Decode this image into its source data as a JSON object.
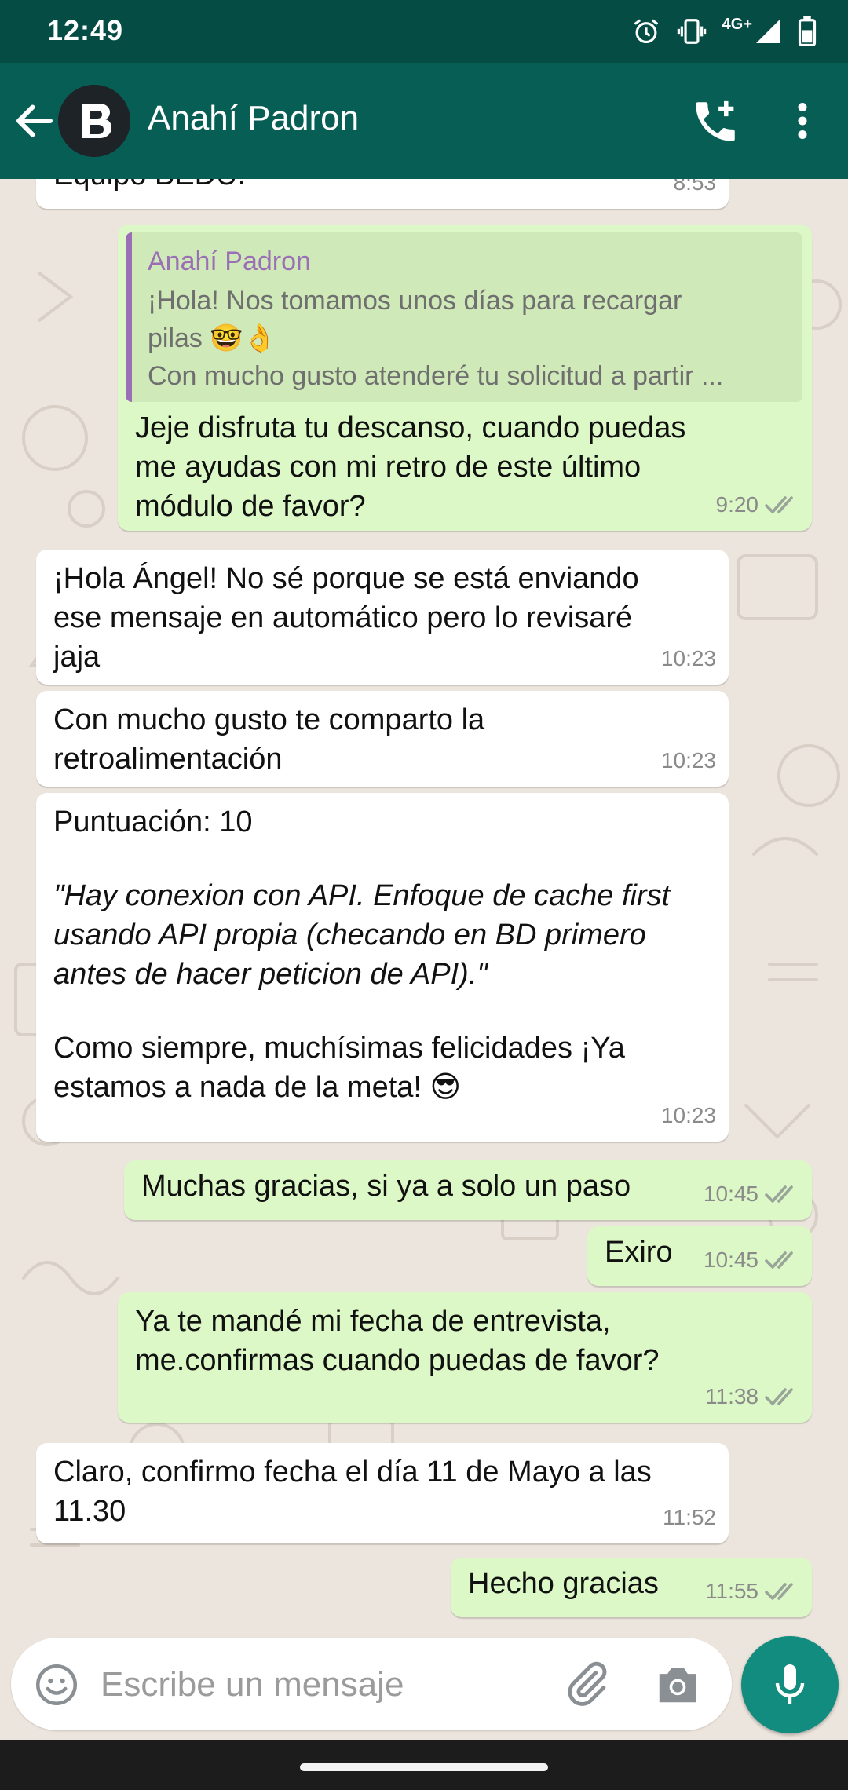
{
  "status_bar": {
    "time": "12:49",
    "network": "4G+",
    "icons": [
      "alarm-icon",
      "vibrate-icon",
      "signal-icon",
      "battery-icon"
    ]
  },
  "header": {
    "contact_name": "Anahí Padron",
    "avatar_letter": "B",
    "icons": [
      "back-arrow-icon",
      "add-call-icon",
      "more-vert-icon"
    ]
  },
  "messages": [
    {
      "direction": "in",
      "text": "Equipo BEDU.",
      "time": "8:53"
    },
    {
      "direction": "out",
      "quote": {
        "author": "Anahí Padron",
        "line1": "¡Hola! Nos tomamos unos días para recargar",
        "line2": "pilas 🤓👌",
        "line3": "Con mucho gusto atenderé tu solicitud a partir ..."
      },
      "text": "Jeje disfruta tu descanso, cuando puedas\nme ayudas con mi retro de este último\nmódulo de favor?",
      "time": "9:20",
      "status": "read"
    },
    {
      "direction": "in",
      "text": "¡Hola Ángel! No sé porque se está enviando\nese mensaje en automático pero lo revisaré\njaja",
      "time": "10:23"
    },
    {
      "direction": "in",
      "text": "Con mucho gusto te comparto la\nretroalimentación",
      "time": "10:23"
    },
    {
      "direction": "in",
      "text": "Puntuación: 10",
      "quote_text": "\"Hay conexion con API. Enfoque de cache first\nusando API propia (checando en BD primero\nantes de hacer peticion de API).\"",
      "text2": "Como siempre, muchísimas felicidades ¡Ya\nestamos a nada de la meta! 😎",
      "time": "10:23"
    },
    {
      "direction": "out",
      "text": "Muchas gracias, si ya a solo un paso",
      "time": "10:45",
      "status": "read"
    },
    {
      "direction": "out",
      "text": "Exiro",
      "time": "10:45",
      "status": "read"
    },
    {
      "direction": "out",
      "text": "Ya te mandé mi fecha de entrevista,\nme.confirmas cuando puedas de favor?",
      "time": "11:38",
      "status": "read"
    },
    {
      "direction": "in",
      "text": "Claro, confirmo fecha el día 11 de Mayo a las\n11.30",
      "time": "11:52"
    },
    {
      "direction": "out",
      "text": "Hecho gracias",
      "time": "11:55",
      "status": "read"
    }
  ],
  "composer": {
    "placeholder": "Escribe un mensaje",
    "value": "",
    "icons": [
      "emoji-icon",
      "attach-icon",
      "camera-icon",
      "mic-icon"
    ]
  },
  "colors": {
    "status_bar": "#054d44",
    "app_bar": "#075e54",
    "outgoing_bubble": "#dcf8c6",
    "incoming_bubble": "#ffffff",
    "chat_background": "#ece5dd",
    "read_ticks": "#9aa59a",
    "quote_author": "#9b6fb5",
    "mic_button": "#128c7e"
  }
}
